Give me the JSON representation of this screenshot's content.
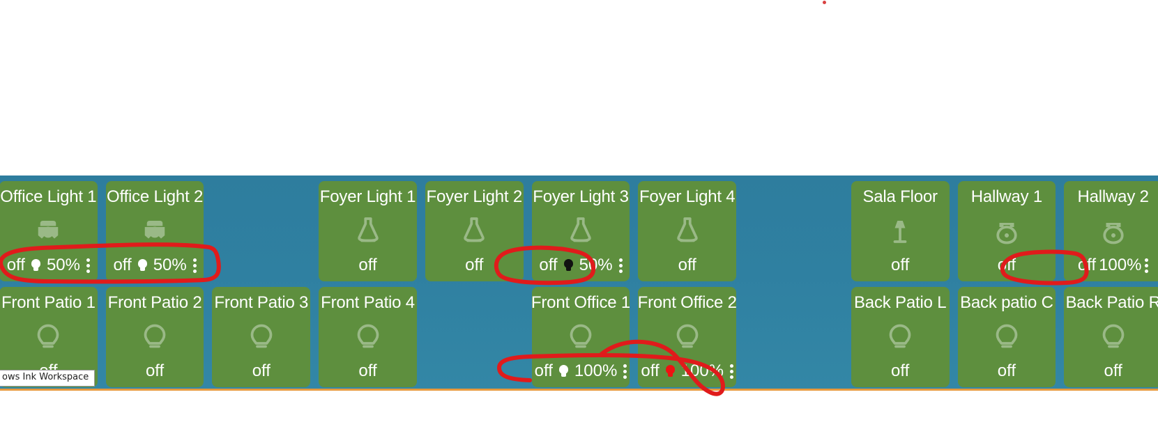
{
  "window": {
    "background_top": "#ffffff",
    "panel_gradient_from": "#2e7d9e",
    "panel_gradient_to": "#3387a6",
    "card_color": "#5e8f3e",
    "card_text_color": "#ffffff",
    "icon_color": "#9ab987",
    "accent_orange": "#e89a3e",
    "ink_color": "#e01b1b"
  },
  "taskbar_tooltip": {
    "label": "ows Ink Workspace",
    "name": "windows-ink-workspace-tooltip"
  },
  "status_labels": {
    "off": "off",
    "pct_50": "50%",
    "pct_100": "100%"
  },
  "cards": [
    {
      "name": "Office Light 1",
      "icon": "flood-light-icon",
      "slot": 0,
      "state": "off",
      "bulb": "white",
      "brightness": "50%",
      "kebab": true
    },
    {
      "name": "Office Light 2",
      "icon": "flood-light-icon",
      "slot": 1,
      "state": "off",
      "bulb": "white",
      "brightness": "50%",
      "kebab": true
    },
    {
      "name": "Foyer Light 1",
      "icon": "reflector-bulb-icon",
      "slot": 3,
      "state": "off",
      "bulb": null,
      "brightness": null,
      "kebab": false
    },
    {
      "name": "Foyer Light 2",
      "icon": "reflector-bulb-icon",
      "slot": 4,
      "state": "off",
      "bulb": null,
      "brightness": null,
      "kebab": false
    },
    {
      "name": "Foyer Light 3",
      "icon": "reflector-bulb-icon",
      "slot": 5,
      "state": "off",
      "bulb": "black",
      "brightness": "50%",
      "kebab": true
    },
    {
      "name": "Foyer Light 4",
      "icon": "reflector-bulb-icon",
      "slot": 6,
      "state": "off",
      "bulb": null,
      "brightness": null,
      "kebab": false
    },
    {
      "name": "Sala Floor",
      "icon": "floor-lamp-icon",
      "slot": 8,
      "state": "off",
      "bulb": null,
      "brightness": null,
      "kebab": false
    },
    {
      "name": "Hallway 1",
      "icon": "pendant-lamp-icon",
      "slot": 9,
      "state": "off",
      "bulb": null,
      "brightness": null,
      "kebab": false
    },
    {
      "name": "Hallway 2",
      "icon": "pendant-lamp-icon",
      "slot": 10,
      "state": "off",
      "bulb": null,
      "brightness": "100%",
      "kebab": true
    },
    {
      "name": "Front Patio 1",
      "icon": "bulb-icon",
      "slot": 11,
      "state": "off",
      "bulb": null,
      "brightness": null,
      "kebab": false
    },
    {
      "name": "Front Patio 2",
      "icon": "bulb-icon",
      "slot": 12,
      "state": "off",
      "bulb": null,
      "brightness": null,
      "kebab": false
    },
    {
      "name": "Front Patio 3",
      "icon": "bulb-icon",
      "slot": 13,
      "state": "off",
      "bulb": null,
      "brightness": null,
      "kebab": false
    },
    {
      "name": "Front Patio 4",
      "icon": "bulb-icon",
      "slot": 14,
      "state": "off",
      "bulb": null,
      "brightness": null,
      "kebab": false
    },
    {
      "name": "Front Office 1",
      "icon": "bulb-icon",
      "slot": 16,
      "state": "off",
      "bulb": "white",
      "brightness": "100%",
      "kebab": true
    },
    {
      "name": "Front Office 2",
      "icon": "bulb-icon",
      "slot": 17,
      "state": "off",
      "bulb": "red",
      "brightness": "100%",
      "kebab": true
    },
    {
      "name": "Back Patio L",
      "icon": "bulb-icon",
      "slot": 19,
      "state": "off",
      "bulb": null,
      "brightness": null,
      "kebab": false
    },
    {
      "name": "Back patio C",
      "icon": "bulb-icon",
      "slot": 20,
      "state": "off",
      "bulb": null,
      "brightness": null,
      "kebab": false
    },
    {
      "name": "Back Patio R",
      "icon": "bulb-icon",
      "slot": 21,
      "state": "off",
      "bulb": null,
      "brightness": null,
      "kebab": false
    }
  ],
  "annotations": [
    {
      "name": "ink-circle-office-lights"
    },
    {
      "name": "ink-circle-foyer-light-3"
    },
    {
      "name": "ink-circle-hallway-2"
    },
    {
      "name": "ink-circle-front-offices"
    }
  ]
}
